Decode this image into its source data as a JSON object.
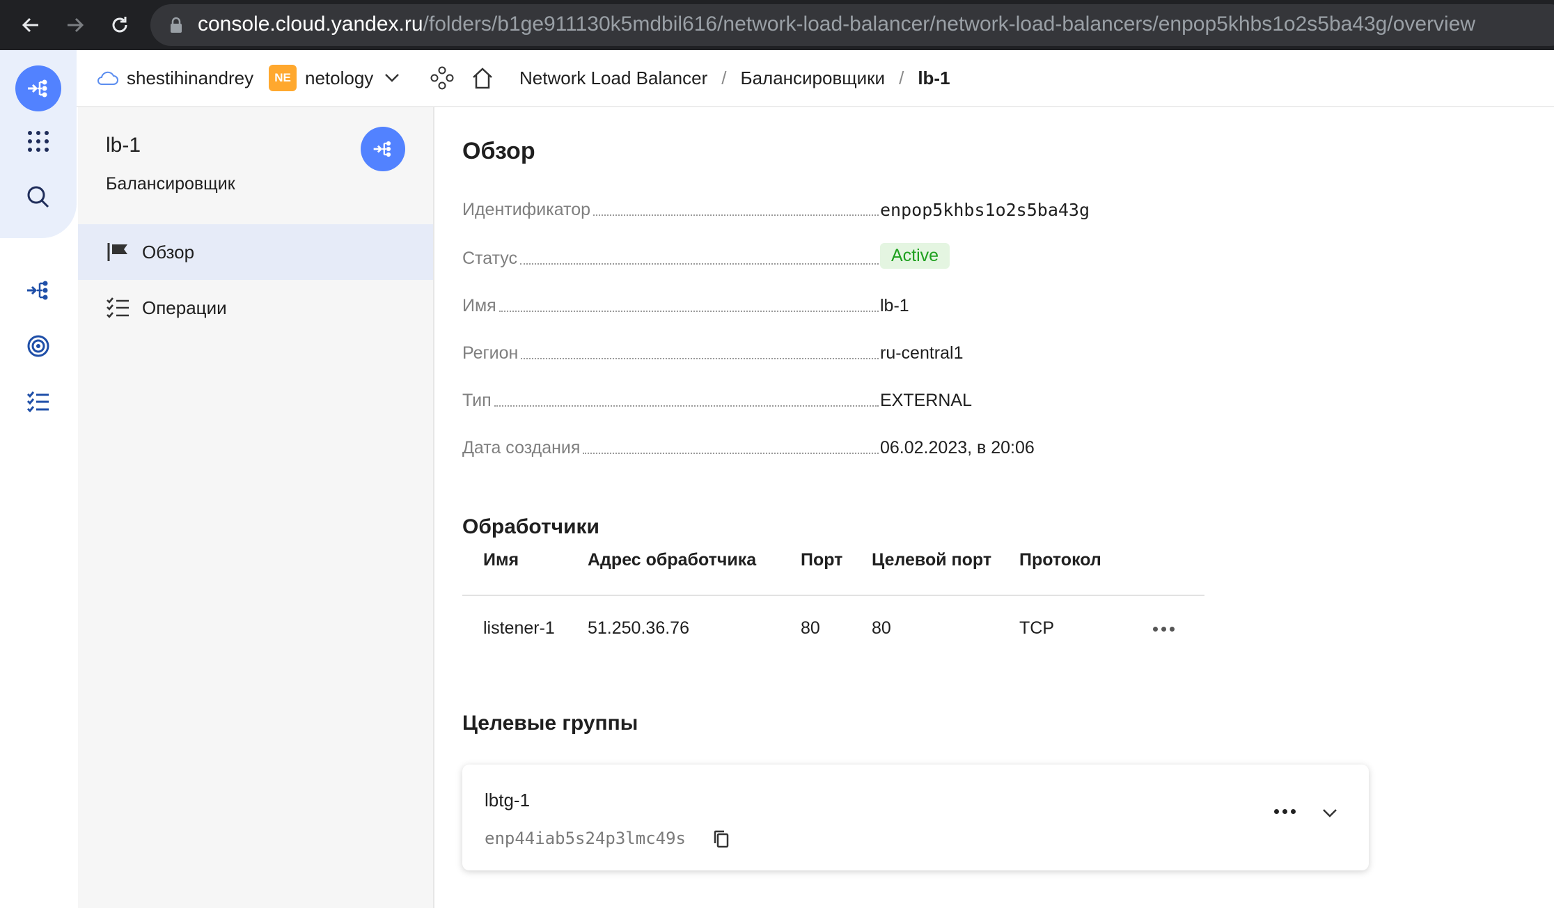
{
  "browser": {
    "url_host": "console.cloud.yandex.ru",
    "url_path": "/folders/b1ge911130k5mdbil616/network-load-balancer/network-load-balancers/enpop5khbs1o2s5ba43g/overview"
  },
  "header": {
    "cloud_name": "shestihinandrey",
    "folder_badge": "NE",
    "folder_name": "netology",
    "breadcrumbs": [
      "Network Load Balancer",
      "/",
      "Балансировщики",
      "/",
      "lb-1"
    ]
  },
  "sidebar": {
    "title": "lb-1",
    "subtitle": "Балансировщик",
    "items": [
      {
        "label": "Обзор",
        "icon": "flag-icon",
        "active": true
      },
      {
        "label": "Операции",
        "icon": "list-icon",
        "active": false
      }
    ]
  },
  "overview": {
    "title": "Обзор",
    "props": [
      {
        "label": "Идентификатор",
        "value": "enpop5khbs1o2s5ba43g"
      },
      {
        "label": "Статус",
        "value": "Active"
      },
      {
        "label": "Имя",
        "value": "lb-1"
      },
      {
        "label": "Регион",
        "value": "ru-central1"
      },
      {
        "label": "Тип",
        "value": "EXTERNAL"
      },
      {
        "label": "Дата создания",
        "value": "06.02.2023, в 20:06"
      }
    ]
  },
  "listeners": {
    "title": "Обработчики",
    "columns": [
      "Имя",
      "Адрес обработчика",
      "Порт",
      "Целевой порт",
      "Протокол"
    ],
    "rows": [
      [
        "listener-1",
        "51.250.36.76",
        "80",
        "80",
        "TCP"
      ]
    ]
  },
  "target_groups": {
    "title": "Целевые группы",
    "items": [
      {
        "name": "lbtg-1",
        "id": "enp44iab5s24p3lmc49s"
      }
    ]
  },
  "colors": {
    "accent": "#5282ff",
    "status_active_bg": "#e4f5e1",
    "status_active_text": "#1ea01e",
    "folder_badge": "#ffa82e"
  }
}
